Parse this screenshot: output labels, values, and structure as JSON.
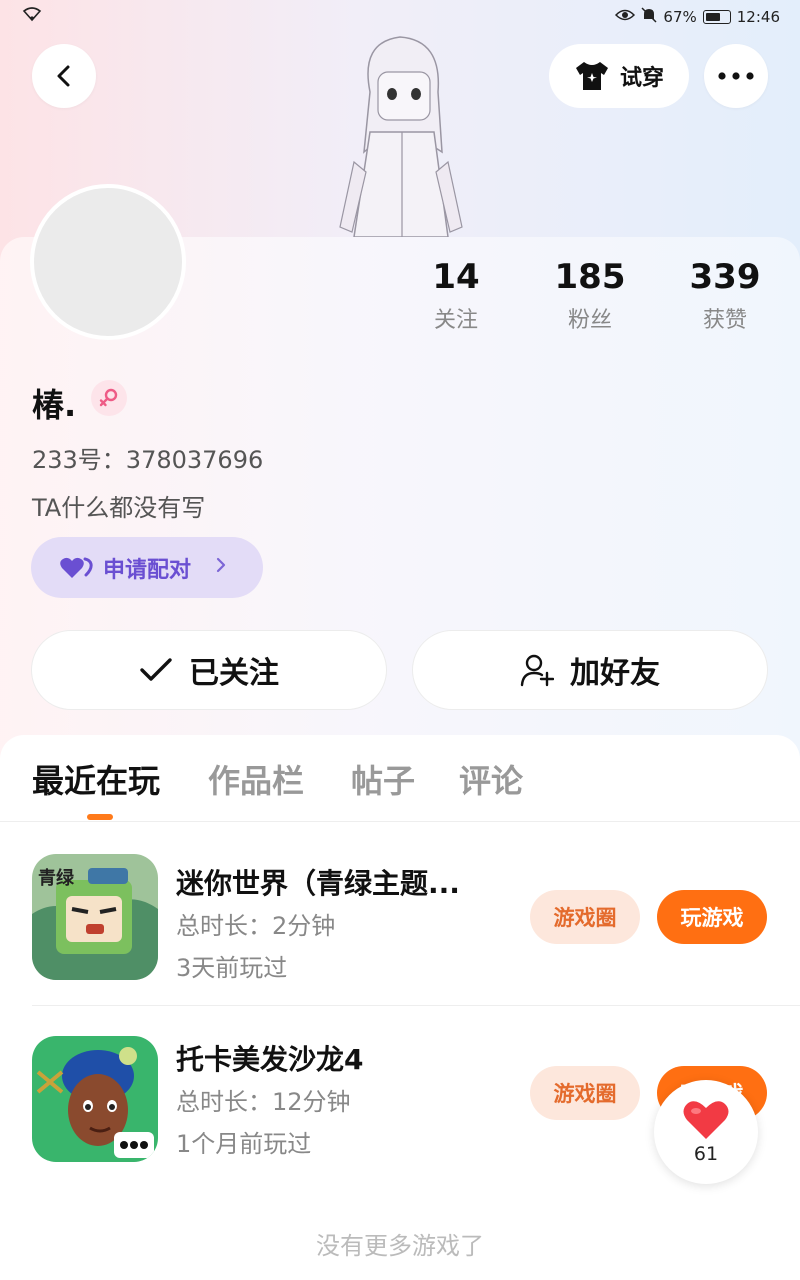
{
  "status_bar": {
    "battery": "67%",
    "time": "12:46"
  },
  "header": {
    "try_on_label": "试穿"
  },
  "profile": {
    "stats": [
      {
        "value": "14",
        "label": "关注"
      },
      {
        "value": "185",
        "label": "粉丝"
      },
      {
        "value": "339",
        "label": "获赞"
      }
    ],
    "name": "椿.",
    "uid": "233号：378037696",
    "bio": "TA什么都没有写",
    "pair_label": "申请配对",
    "follow_label": "已关注",
    "add_friend_label": "加好友"
  },
  "tabs": [
    "最近在玩",
    "作品栏",
    "帖子",
    "评论"
  ],
  "games": [
    {
      "title": "迷你世界（青绿主题...",
      "duration": "总时长：2分钟",
      "last_played": "3天前玩过",
      "circle_label": "游戏圈",
      "play_label": "玩游戏"
    },
    {
      "title": "托卡美发沙龙4",
      "duration": "总时长：12分钟",
      "last_played": "1个月前玩过",
      "circle_label": "游戏圈",
      "play_label": "玩游戏"
    }
  ],
  "like_fab": {
    "count": "61"
  },
  "footer_note": "没有更多游戏了",
  "colors": {
    "accent": "#ff6f12",
    "pair_purple": "#6a4fd2",
    "pill_bg": "#fde7dc"
  }
}
